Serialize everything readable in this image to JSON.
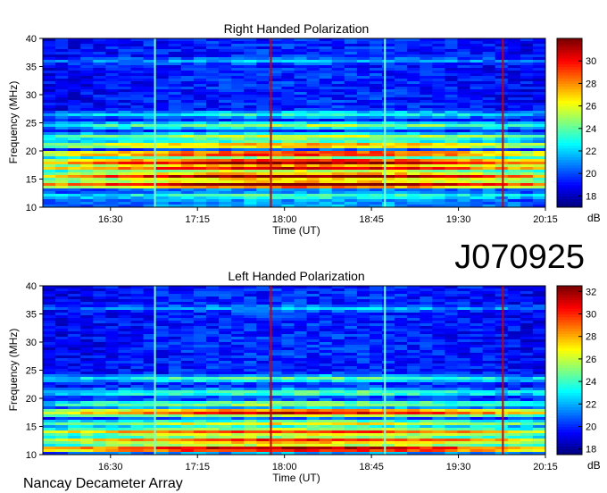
{
  "figure": {
    "id_label": "J070925",
    "footer": "Nancay Decameter Array"
  },
  "palette": {
    "low": "#00007f",
    "mid": "#00ffff",
    "high": "#7f0000"
  },
  "chart_data": [
    {
      "type": "heatmap",
      "title": "Right Handed Polarization",
      "xlabel": "Time (UT)",
      "ylabel": "Frequency (MHz)",
      "x_ticks": [
        "16:30",
        "17:15",
        "18:00",
        "18:45",
        "19:30",
        "20:15"
      ],
      "y_ticks": [
        10,
        15,
        20,
        25,
        30,
        35,
        40
      ],
      "ylim": [
        10,
        40
      ],
      "xlim_minutes_ut": [
        955,
        1215
      ],
      "colorbar": {
        "label": "dB",
        "ticks": [
          18,
          20,
          22,
          24,
          26,
          28,
          30
        ],
        "range": [
          17,
          32
        ]
      },
      "vertical_markers": [
        {
          "time": "16:53",
          "color": "#7fffcf"
        },
        {
          "time": "17:53",
          "color": "#cc0000"
        },
        {
          "time": "18:52",
          "color": "#7fffcf"
        },
        {
          "time": "19:53",
          "color": "#cc0000"
        }
      ],
      "emission_bands_mhz": [
        {
          "freq": 12.0,
          "level": 0.45
        },
        {
          "freq": 14.0,
          "level": 1.0
        },
        {
          "freq": 15.5,
          "level": 0.95
        },
        {
          "freq": 17.0,
          "level": 0.9
        },
        {
          "freq": 18.0,
          "level": 1.0
        },
        {
          "freq": 19.5,
          "level": 0.9
        },
        {
          "freq": 21.0,
          "level": 0.75
        },
        {
          "freq": 22.5,
          "level": 0.6
        },
        {
          "freq": 24.5,
          "level": 0.5
        },
        {
          "freq": 26.5,
          "level": 0.4
        },
        {
          "freq": 36.0,
          "level": 0.3
        }
      ]
    },
    {
      "type": "heatmap",
      "title": "Left Handed Polarization",
      "xlabel": "Time (UT)",
      "ylabel": "Frequency (MHz)",
      "x_ticks": [
        "16:30",
        "17:15",
        "18:00",
        "18:45",
        "19:30",
        "20:15"
      ],
      "y_ticks": [
        10,
        15,
        20,
        25,
        30,
        35,
        40
      ],
      "ylim": [
        10,
        40
      ],
      "xlim_minutes_ut": [
        955,
        1215
      ],
      "colorbar": {
        "label": "dB",
        "ticks": [
          18,
          20,
          22,
          24,
          26,
          28,
          30,
          32
        ],
        "range": [
          17.5,
          32.5
        ]
      },
      "vertical_markers": [
        {
          "time": "16:53",
          "color": "#7fffcf"
        },
        {
          "time": "17:53",
          "color": "#cc0000"
        },
        {
          "time": "18:52",
          "color": "#7fffcf"
        },
        {
          "time": "19:53",
          "color": "#cc0000"
        }
      ],
      "emission_bands_mhz": [
        {
          "freq": 11.0,
          "level": 1.0
        },
        {
          "freq": 12.5,
          "level": 0.85
        },
        {
          "freq": 14.0,
          "level": 0.8
        },
        {
          "freq": 15.5,
          "level": 0.6
        },
        {
          "freq": 17.5,
          "level": 0.9
        },
        {
          "freq": 19.0,
          "level": 0.55
        },
        {
          "freq": 21.0,
          "level": 0.5
        },
        {
          "freq": 23.5,
          "level": 0.45
        },
        {
          "freq": 36.0,
          "level": 0.3
        }
      ]
    }
  ]
}
